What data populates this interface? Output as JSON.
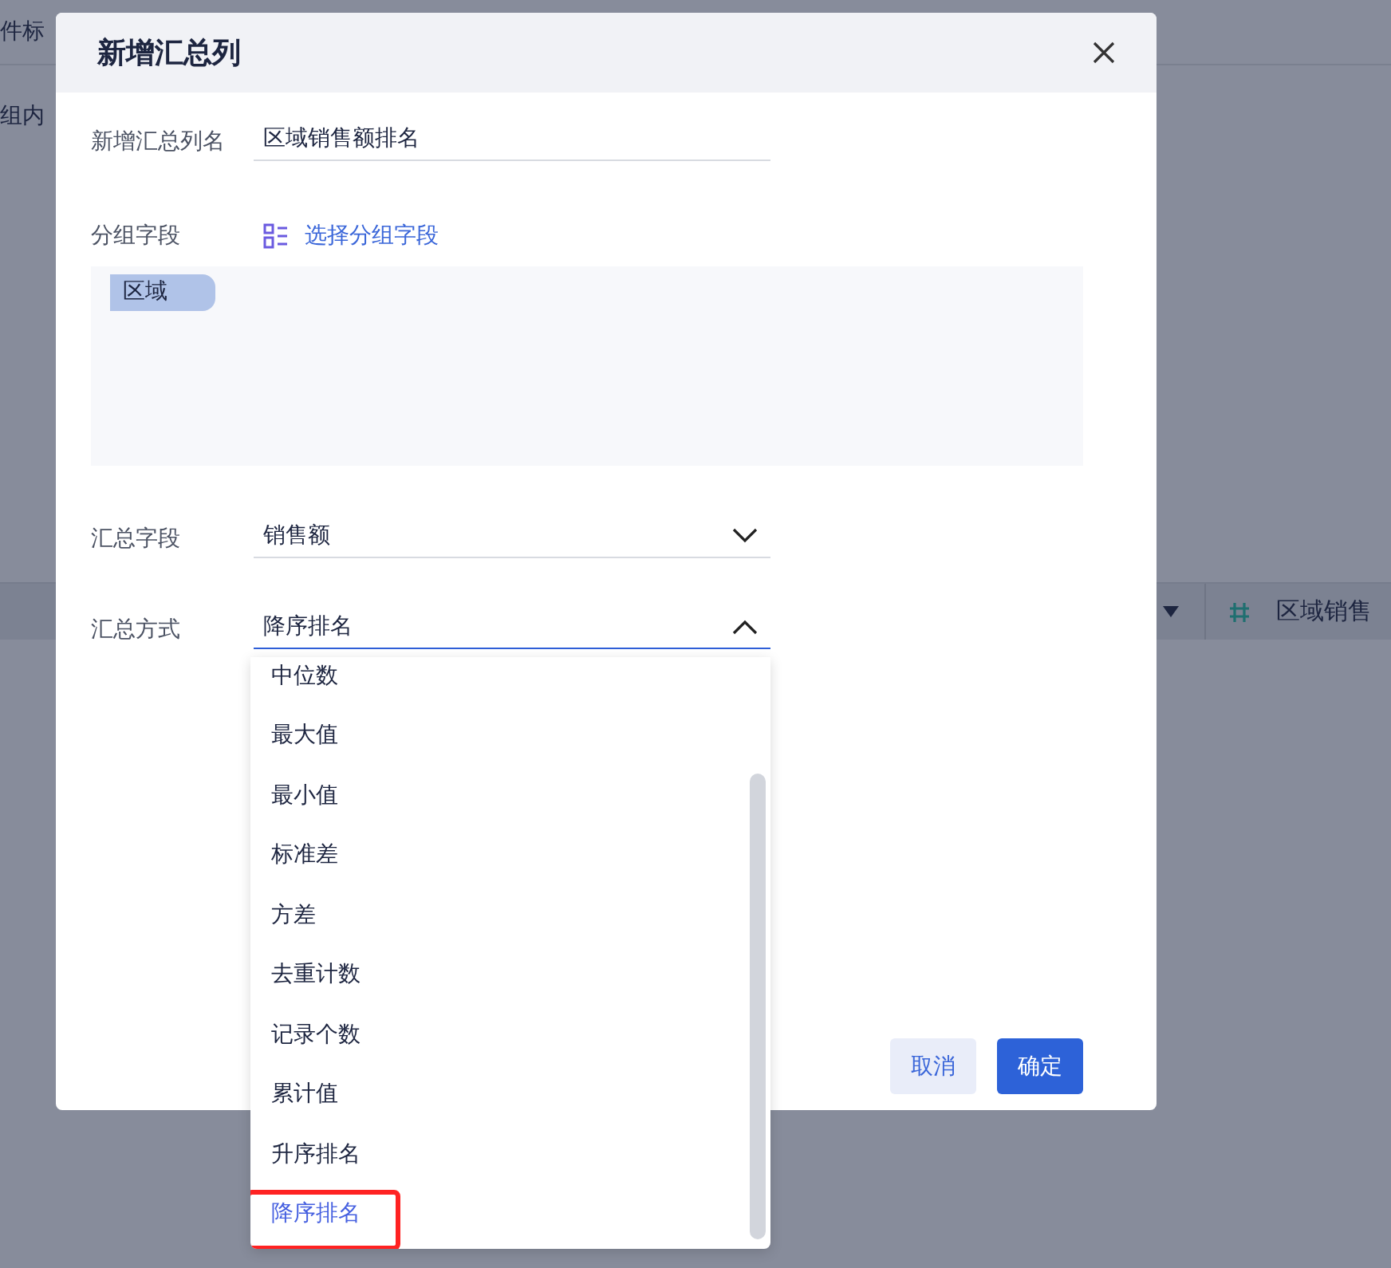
{
  "background": {
    "top_label": "件标",
    "group_label": "组内",
    "column_header": "区域销售"
  },
  "dialog": {
    "title": "新增汇总列",
    "name_field": {
      "label": "新增汇总列名",
      "value": "区域销售额排名"
    },
    "group_field": {
      "label": "分组字段",
      "link": "选择分组字段",
      "tags": [
        "区域"
      ]
    },
    "summary_field": {
      "label": "汇总字段",
      "value": "销售额",
      "open": false
    },
    "summary_method": {
      "label": "汇总方式",
      "value": "降序排名",
      "open": true
    },
    "buttons": [
      {
        "label": "取消",
        "kind": "secondary"
      },
      {
        "label": "确定",
        "kind": "primary"
      }
    ]
  },
  "dropdown": [
    {
      "label": "中位数",
      "selected": false,
      "highlighted": false
    },
    {
      "label": "最大值",
      "selected": false,
      "highlighted": false
    },
    {
      "label": "最小值",
      "selected": false,
      "highlighted": false
    },
    {
      "label": "标准差",
      "selected": false,
      "highlighted": false
    },
    {
      "label": "方差",
      "selected": false,
      "highlighted": false
    },
    {
      "label": "去重计数",
      "selected": false,
      "highlighted": false
    },
    {
      "label": "记录个数",
      "selected": false,
      "highlighted": false
    },
    {
      "label": "累计值",
      "selected": false,
      "highlighted": false
    },
    {
      "label": "升序排名",
      "selected": false,
      "highlighted": false
    },
    {
      "label": "降序排名",
      "selected": true,
      "highlighted": true
    }
  ]
}
